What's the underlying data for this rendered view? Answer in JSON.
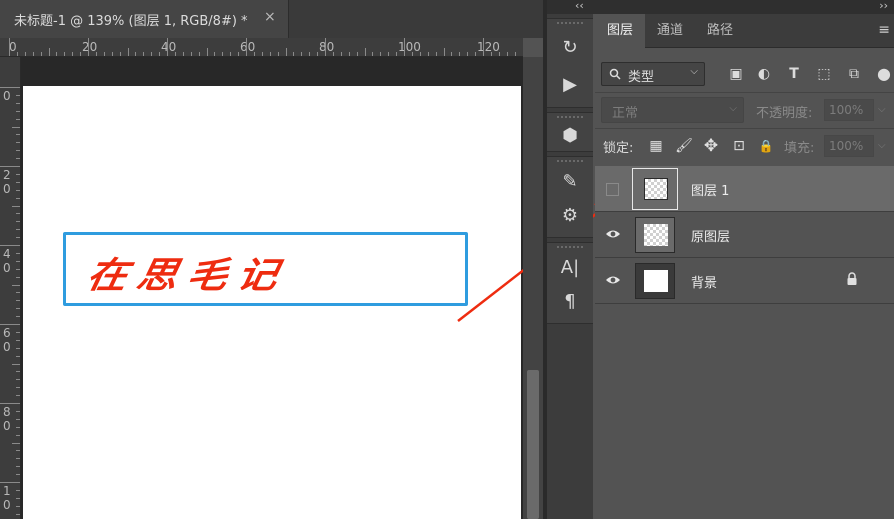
{
  "document": {
    "tab_title": "未标题-1 @ 139% (图层 1, RGB/8#) *",
    "close_glyph": "×"
  },
  "ruler": {
    "top_labels": [
      "0",
      "20",
      "40",
      "60",
      "80",
      "100",
      "120"
    ],
    "left_labels": [
      "0",
      "20",
      "40",
      "60",
      "80",
      "10"
    ]
  },
  "canvas": {
    "logo_text": "在思毛记",
    "logo_color": "#ee2c10",
    "selection_color": "#2f9cdf",
    "arrow_color": "#ee2c10"
  },
  "toolstrip": {
    "collapse_glyph": "‹‹",
    "tools": [
      {
        "icon": "history-icon",
        "glyph": "↻"
      },
      {
        "icon": "play-action-icon",
        "glyph": "▶"
      },
      {
        "icon": "3d-cube-icon",
        "glyph": "⬢"
      },
      {
        "icon": "brush-presets-icon",
        "glyph": "✎"
      },
      {
        "icon": "adjust-sliders-icon",
        "glyph": "⚙"
      },
      {
        "icon": "character-icon",
        "glyph": "A|"
      },
      {
        "icon": "paragraph-icon",
        "glyph": "¶"
      }
    ]
  },
  "panel": {
    "expand_glyph": "››",
    "menu_glyph": "≡",
    "tabs": [
      {
        "label": "图层",
        "active": true
      },
      {
        "label": "通道",
        "active": false
      },
      {
        "label": "路径",
        "active": false
      }
    ],
    "filter": {
      "type_label": "类型",
      "search_glyph": "🔍",
      "icons": [
        {
          "name": "image-filter-icon",
          "glyph": "▣"
        },
        {
          "name": "adjustment-filter-icon",
          "glyph": "◐"
        },
        {
          "name": "type-filter-icon",
          "glyph": "T"
        },
        {
          "name": "shape-filter-icon",
          "glyph": "⬚"
        },
        {
          "name": "smart-object-filter-icon",
          "glyph": "⧉"
        }
      ]
    },
    "blend_mode": "正常",
    "opacity_label": "不透明度:",
    "opacity_value": "100%",
    "lock_label": "锁定:",
    "lock_icons": [
      {
        "name": "lock-transparent-icon",
        "glyph": "▦"
      },
      {
        "name": "lock-paint-icon",
        "glyph": "🖌"
      },
      {
        "name": "lock-position-icon",
        "glyph": "✥"
      },
      {
        "name": "lock-artboard-icon",
        "glyph": "⊡"
      },
      {
        "name": "lock-all-icon",
        "glyph": "🔒"
      }
    ],
    "fill_label": "填充:",
    "fill_value": "100%"
  },
  "layers": [
    {
      "name": "图层 1",
      "visible": false,
      "selected": true,
      "thumb": "checker"
    },
    {
      "name": "原图层",
      "visible": true,
      "selected": false,
      "thumb": "checker"
    },
    {
      "name": "背景",
      "visible": true,
      "selected": false,
      "thumb": "white",
      "locked": true
    }
  ]
}
